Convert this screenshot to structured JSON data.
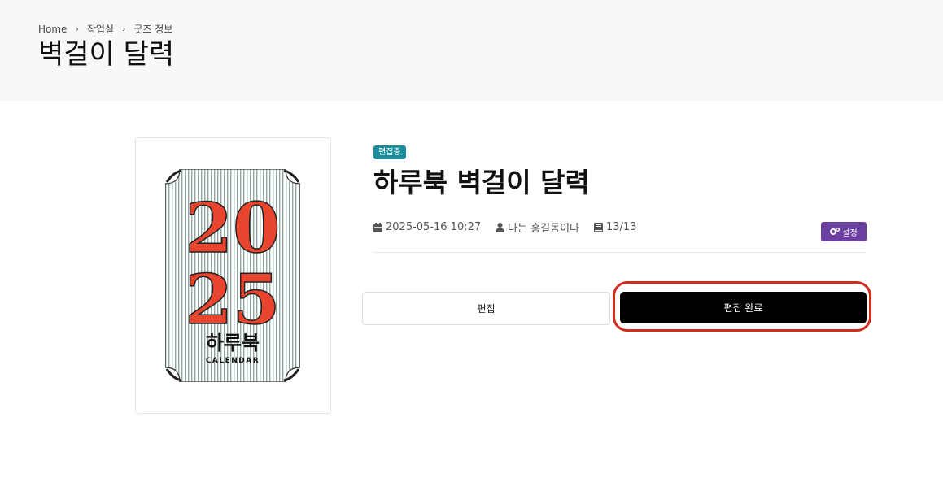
{
  "breadcrumb": {
    "home": "Home",
    "studio": "작업실",
    "current": "굿즈 정보"
  },
  "page_title": "벽걸이 달력",
  "product": {
    "status_badge": "편집중",
    "name": "하루북 벽걸이 달력",
    "date": "2025-05-16 10:27",
    "author": "나는 홍길동이다",
    "pages": "13/13",
    "cover": {
      "year_top": "20",
      "year_bottom": "25",
      "brand": "하루북",
      "subtitle": "CALENDAR"
    }
  },
  "buttons": {
    "settings": "설정",
    "edit": "편집",
    "done": "편집 완료"
  },
  "colors": {
    "badge": "#1a8c9c",
    "settings": "#6b3fa0",
    "highlight": "#d22b1e",
    "cover_red": "#e8452e"
  },
  "icons": {
    "date": "calendar-icon",
    "author": "user-icon",
    "pages": "book-icon",
    "settings": "gears-icon",
    "separator": "chevron-right-icon"
  }
}
